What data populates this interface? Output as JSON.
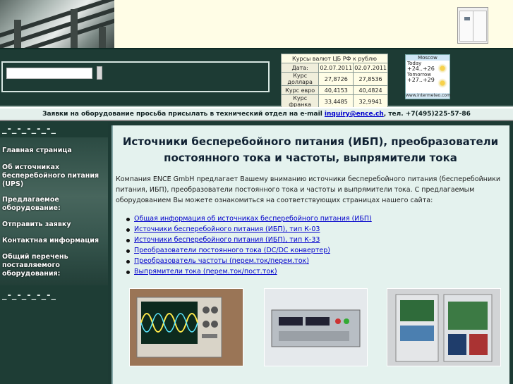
{
  "search": {
    "value": "",
    "button_label": ""
  },
  "rates": {
    "title": "Курсы валют ЦБ РФ к рублю",
    "date_label": "Дата:",
    "dates": [
      "02.07.2011",
      "02.07.2011"
    ],
    "rows": [
      {
        "label": "Курс доллара",
        "v1": "27,8726",
        "v2": "27,8536"
      },
      {
        "label": "Курс евро",
        "v1": "40,4153",
        "v2": "40,4824"
      },
      {
        "label": "Курс франка",
        "v1": "33,4485",
        "v2": "32,9941"
      }
    ]
  },
  "weather": {
    "city": "Moscow",
    "today_label": "Today",
    "today_temp": "+24..+26",
    "tomorrow_label": "Tomorrow",
    "tomorrow_temp": "+27..+29",
    "site": "www.intermeteo.com"
  },
  "notice": {
    "text_before": "Заявки на оборудование просьба присылать в технический отдел на e-mail ",
    "email": "inquiry@ence.ch",
    "text_after": ", тел. +7(495)225-57-86"
  },
  "sidebar": {
    "deco_top": "_-_-_-_-_-_",
    "deco_bottom": "_-_-_-_-_-_",
    "items": [
      {
        "label": "Главная страница"
      },
      {
        "label": "Об источниках бесперебойного питания (UPS)"
      },
      {
        "label": "Предлагаемое оборудование:"
      },
      {
        "label": "Отправить заявку"
      },
      {
        "label": "Контактная информация"
      },
      {
        "label": "Общий перечень поставляемого оборудования:"
      }
    ]
  },
  "main": {
    "title": "Источники бесперебойного питания (ИБП), преобразователи постоянного тока и частоты, выпрямители тока",
    "intro": "Компания ENCE GmbH предлагает Вашему вниманию источники бесперебойного питания (бесперебойники питания, ИБП), преобразователи постоянного тока и частоты и выпрямители тока. С предлагаемым оборудованием Вы можете ознакомиться на соответствующих страницах нашего сайта:",
    "links": [
      {
        "label": "Общая информация об источниках бесперебойного питания (ИБП)"
      },
      {
        "label": "Источники бесперебойного питания (ИБП), тип К-03"
      },
      {
        "label": "Источники бесперебойного питания (ИБП), тип К-33"
      },
      {
        "label": "Преобразователи постоянного тока (DC/DC конвертер)"
      },
      {
        "label": "Преобразователь частоты (перем.ток/перем.ток)"
      },
      {
        "label": "Выпрямители тока (перем.ток/пост.ток)"
      }
    ]
  }
}
